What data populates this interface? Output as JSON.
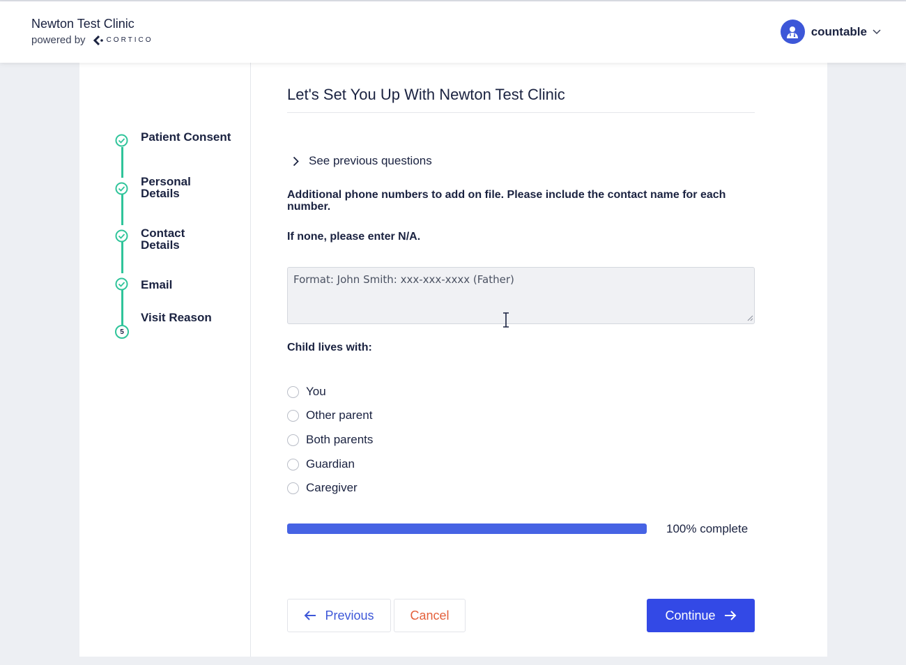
{
  "header": {
    "clinic_name": "Newton Test Clinic",
    "powered_by": "powered by",
    "brand": "CORTICO",
    "user": "countable"
  },
  "steps": [
    {
      "label": "Patient Consent",
      "status": "complete"
    },
    {
      "label": "Personal Details",
      "status": "complete"
    },
    {
      "label": "Contact Details",
      "status": "complete"
    },
    {
      "label": "Email",
      "status": "complete"
    },
    {
      "label": "Visit Reason",
      "status": "current",
      "number": "5"
    }
  ],
  "main": {
    "title": "Let's Set You Up With Newton Test Clinic",
    "see_previous": "See previous questions",
    "question": "Additional phone numbers to add on file. Please include the contact name for each number.",
    "sub_question": "If none, please enter N/A.",
    "textarea_placeholder": "Format: John Smith: xxx-xxx-xxxx (Father)",
    "radio_label": "Child lives with:",
    "radio_options": [
      "You",
      "Other parent",
      "Both parents",
      "Guardian",
      "Caregiver"
    ],
    "progress_value": 1.0,
    "progress_text": "100% complete"
  },
  "buttons": {
    "previous": "Previous",
    "cancel": "Cancel",
    "continue": "Continue"
  },
  "colors": {
    "accent": "#3349e6",
    "step_green": "#2fc49a",
    "cancel_red": "#e4603b"
  }
}
